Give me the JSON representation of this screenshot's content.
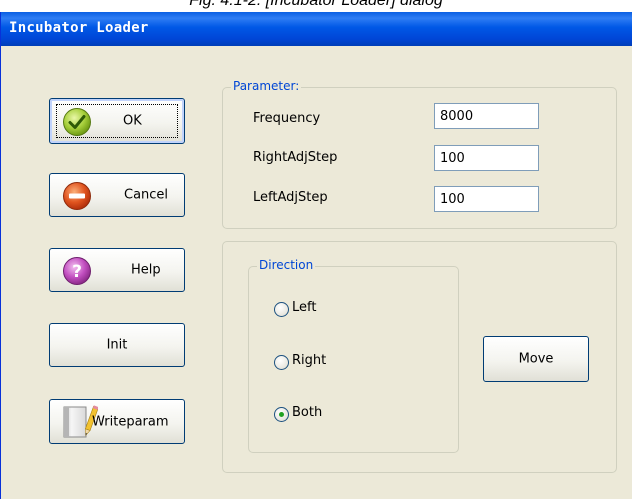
{
  "caption": "Fig. 4.1-2: [Incubator Loader] dialog",
  "window": {
    "title": "Incubator Loader"
  },
  "buttons": {
    "ok": "OK",
    "cancel": "Cancel",
    "help": "Help",
    "init": "Init",
    "writeparam": "Writeparam",
    "move": "Move"
  },
  "parameter": {
    "legend": "Parameter:",
    "frequency": {
      "label": "Frequency",
      "value": "8000"
    },
    "right_adj_step": {
      "label": "RightAdjStep",
      "value": "100"
    },
    "left_adj_step": {
      "label": "LeftAdjStep",
      "value": "100"
    }
  },
  "direction": {
    "legend": "Direction",
    "options": [
      {
        "label": "Left",
        "selected": false
      },
      {
        "label": "Right",
        "selected": false
      },
      {
        "label": "Both",
        "selected": true
      }
    ]
  },
  "colors": {
    "titlebar": "#0054e3",
    "window_bg": "#ece9d8",
    "group_legend": "#0046d5",
    "radio_selected": "#21a121"
  },
  "icons": {
    "ok": "check-icon",
    "cancel": "minus-icon",
    "help": "question-icon",
    "writeparam": "notebook-pencil-icon"
  }
}
